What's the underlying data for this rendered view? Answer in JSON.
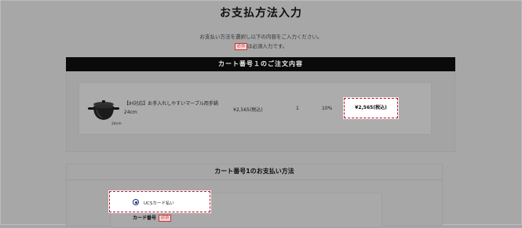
{
  "page": {
    "title": "お支払方法入力",
    "instruction_line1": "お支払い方法を選択し以下の内容をご入力ください。",
    "required_badge": "必須",
    "instruction_line2_suffix": "は必須入力です。"
  },
  "cart": {
    "header": "カート番号１のご注文内容",
    "item": {
      "icon": "pot-icon",
      "image_caption": "24cm",
      "name": "【IH対応】お手入れしやすいマーブル両手鍋",
      "variant": "24cm",
      "unit_price": "¥2,565(税込)",
      "quantity": "1",
      "tax_rate": "10%",
      "total": "¥2,565(税込)"
    }
  },
  "payment": {
    "header": "カート番号1のお支払い方法",
    "option_label": "UCSカード払い",
    "option_selected": true,
    "card_label": "カード番号",
    "card_required_badge": "必須"
  },
  "colors": {
    "highlight_border": "#c8102e",
    "header_bg": "#0a0a0a",
    "radio": "#1a2a7a"
  }
}
